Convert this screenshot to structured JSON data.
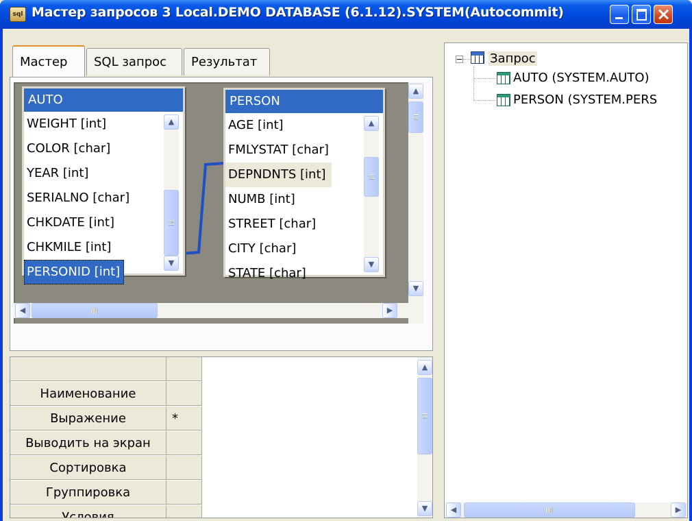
{
  "window": {
    "title": "Мастер запросов 3 Local.DEMO DATABASE (6.1.12).SYSTEM(Autocommit)",
    "icon": "sql-query-app-icon",
    "icon_text": "sql"
  },
  "tabs": [
    {
      "label": "Мастер",
      "active": true
    },
    {
      "label": "SQL запрос",
      "active": false
    },
    {
      "label": "Результат",
      "active": false
    }
  ],
  "designer": {
    "tables": [
      {
        "name": "AUTO",
        "fields": [
          "WEIGHT [int]",
          "COLOR [char]",
          "YEAR [int]",
          "SERIALNO [char]",
          "CHKDATE [int]",
          "CHKMILE [int]",
          "PERSONID [int]"
        ],
        "selected_field": "PERSONID [int]"
      },
      {
        "name": "PERSON",
        "fields": [
          "AGE [int]",
          "FMLYSTAT [char]",
          "DEPNDNTS [int]",
          "NUMB [int]",
          "STREET [char]",
          "CITY [char]",
          "STATE [char]"
        ],
        "highlighted_field": "DEPNDNTS [int]"
      }
    ],
    "join": {
      "from": "AUTO.PERSONID [int]",
      "to": "PERSON.DEPNDNTS [int]",
      "color": "#1f4fc4"
    }
  },
  "grid": {
    "rows": [
      {
        "label": "",
        "value": ""
      },
      {
        "label": "Наименование",
        "value": ""
      },
      {
        "label": "Выражение",
        "value": "*"
      },
      {
        "label": "Выводить на экран",
        "value": ""
      },
      {
        "label": "Сортировка",
        "value": ""
      },
      {
        "label": "Группировка",
        "value": ""
      },
      {
        "label": "Условия",
        "value": ""
      }
    ]
  },
  "tree": {
    "root": "Запрос",
    "children": [
      "AUTO (SYSTEM.AUTO)",
      "PERSON (SYSTEM.PERS"
    ]
  },
  "colors": {
    "title_bar": "#0054e3",
    "selection": "#316ac5",
    "designer_bg": "#8c8a7e",
    "face": "#ece9d8"
  }
}
